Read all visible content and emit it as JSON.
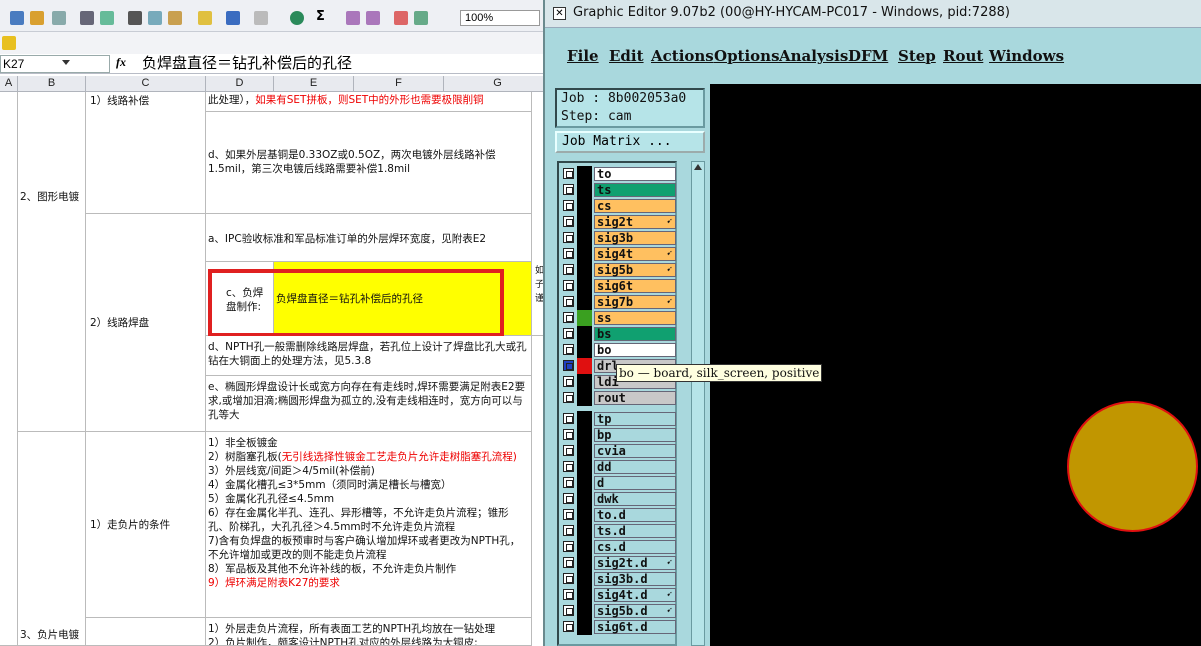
{
  "spreadsheet": {
    "zoom": "100%",
    "name_box": "K27",
    "fx_symbol": "fx",
    "formula": "负焊盘直径＝钻孔补偿后的孔径",
    "columns": [
      "A",
      "B",
      "C",
      "D",
      "E",
      "F",
      "G"
    ],
    "cells": {
      "b_group1": "2、图形电镀",
      "c_line_comp": "1）线路补偿",
      "d_row1": "此处理），如果有SET拼板，则SET中的外形也需要极限削铜",
      "d_row1_a": "此处理），",
      "d_row1_b": "如果有SET拼板，则SET中的外形也需要极限削铜",
      "d_row2": "d、如果外层基铜是0.33OZ或0.5OZ，两次电镀外层线路补偿1.5mil，第三次电镀后线路需要补偿1.8mil",
      "d_row3": "a、IPC验收标准和军品标准订单的外层焊环宽度，见附表E2",
      "c_pad": "2）线路焊盘",
      "d_neg_label": "c、负焊盘制作:",
      "e_neg_value": "负焊盘直径＝钻孔补偿后的孔径",
      "d_row5": "d、NPTH孔一般需删除线路层焊盘，若孔位上设计了焊盘比孔大或孔钻在大铜面上的处理方法，见5.3.8",
      "d_row6": "e、椭圆形焊盘设计长或宽方向存在有走线时,焊环需要满足附表E2要求,或增加泪滴;椭圆形焊盘为孤立的,没有走线相连时，宽方向可以与孔等大",
      "c_neg_film": "1）走负片的条件",
      "neg_cond_1": "1）非全板镀金",
      "neg_cond_2a": "2）树脂塞孔板(",
      "neg_cond_2b": "无引线选择性镀金工艺走负片允许走树脂塞孔流程)",
      "neg_cond_3": "3）外层线宽/间距＞4/5mil(补偿前)",
      "neg_cond_4": "4）金属化槽孔≤3*5mm（须同时满足槽长与槽宽）",
      "neg_cond_5": "5）金属化孔孔径≤4.5mm",
      "neg_cond_6": "6）存在金属化半孔、连孔、异形槽等，不允许走负片流程；锥形孔、阶梯孔，大孔孔径＞4.5mm时不允许走负片流程",
      "neg_cond_7": "7)含有负焊盘的板预审时与客户确认增加焊环或者更改为NPTH孔，不允许增加或更改的则不能走负片流程",
      "neg_cond_8": "8）军品板及其他不允许补线的板，不允许走负片制作",
      "neg_cond_9": "9）焊环满足附表K27的要求",
      "b_group2": "3、负片电镀",
      "d_last1": "1）外层走负片流程，所有表面工艺的NPTH孔均放在一钻处理",
      "d_last2": "2）负片制作，颇客设计NPTH孔对应的外层线路为大铜皮:",
      "side_chars": "如 子 谨"
    }
  },
  "editor": {
    "title": "Graphic Editor 9.07b2 (00@HY-HYCAM-PC017 - Windows, pid:7288)",
    "menu": [
      "File",
      "Edit",
      "Actions",
      "Options",
      "Analysis",
      "DFM",
      "Step",
      "Rout",
      "Windows"
    ],
    "job_label": "Job : 8b002053a0",
    "step_label": "Step: cam",
    "matrix_button": "Job Matrix ...",
    "tooltip": "bo — board, silk_screen, positive",
    "colors": {
      "pad_fill": "#c19600",
      "pad_outline": "#e01010",
      "canvas": "#000000"
    },
    "layers": [
      {
        "name": "to",
        "bg": "#ffffff",
        "sw": "#000000",
        "icon": ""
      },
      {
        "name": "ts",
        "bg": "#10a070",
        "sw": "#000000",
        "icon": ""
      },
      {
        "name": "cs",
        "bg": "#ffc060",
        "sw": "#000000",
        "icon": ""
      },
      {
        "name": "sig2t",
        "bg": "#ffc060",
        "sw": "#000000",
        "icon": "arrow"
      },
      {
        "name": "sig3b",
        "bg": "#ffc060",
        "sw": "#000000",
        "icon": ""
      },
      {
        "name": "sig4t",
        "bg": "#ffc060",
        "sw": "#000000",
        "icon": "arrow"
      },
      {
        "name": "sig5b",
        "bg": "#ffc060",
        "sw": "#000000",
        "icon": "arrow"
      },
      {
        "name": "sig6t",
        "bg": "#ffc060",
        "sw": "#000000",
        "icon": ""
      },
      {
        "name": "sig7b",
        "bg": "#ffc060",
        "sw": "#000000",
        "icon": "arrow"
      },
      {
        "name": "ss",
        "bg": "#ffc060",
        "sw": "#3aa020",
        "icon": ""
      },
      {
        "name": "bs",
        "bg": "#10a070",
        "sw": "#000000",
        "icon": ""
      },
      {
        "name": "bo",
        "bg": "#ffffff",
        "sw": "#000000",
        "icon": ""
      },
      {
        "name": "drl",
        "bg": "#c8c8c8",
        "sw": "#e01010",
        "icon": "",
        "selected": true
      },
      {
        "name": "ldi",
        "bg": "#c8c8c8",
        "sw": "#000000",
        "icon": ""
      },
      {
        "name": "rout",
        "bg": "#c8c8c8",
        "sw": "#000000",
        "icon": ""
      },
      {
        "name": "tp",
        "bg": "#a9d8dd",
        "sw": "#000000",
        "icon": ""
      },
      {
        "name": "bp",
        "bg": "#a9d8dd",
        "sw": "#000000",
        "icon": ""
      },
      {
        "name": "cvia",
        "bg": "#a9d8dd",
        "sw": "#000000",
        "icon": ""
      },
      {
        "name": "dd",
        "bg": "#a9d8dd",
        "sw": "#000000",
        "icon": ""
      },
      {
        "name": "d",
        "bg": "#a9d8dd",
        "sw": "#000000",
        "icon": ""
      },
      {
        "name": "dwk",
        "bg": "#a9d8dd",
        "sw": "#000000",
        "icon": ""
      },
      {
        "name": "to.d",
        "bg": "#a9d8dd",
        "sw": "#000000",
        "icon": ""
      },
      {
        "name": "ts.d",
        "bg": "#a9d8dd",
        "sw": "#000000",
        "icon": ""
      },
      {
        "name": "cs.d",
        "bg": "#a9d8dd",
        "sw": "#000000",
        "icon": ""
      },
      {
        "name": "sig2t.d",
        "bg": "#a9d8dd",
        "sw": "#000000",
        "icon": "arrow"
      },
      {
        "name": "sig3b.d",
        "bg": "#a9d8dd",
        "sw": "#000000",
        "icon": ""
      },
      {
        "name": "sig4t.d",
        "bg": "#a9d8dd",
        "sw": "#000000",
        "icon": "arrow"
      },
      {
        "name": "sig5b.d",
        "bg": "#a9d8dd",
        "sw": "#000000",
        "icon": "arrow"
      },
      {
        "name": "sig6t.d",
        "bg": "#a9d8dd",
        "sw": "#000000",
        "icon": ""
      }
    ]
  }
}
